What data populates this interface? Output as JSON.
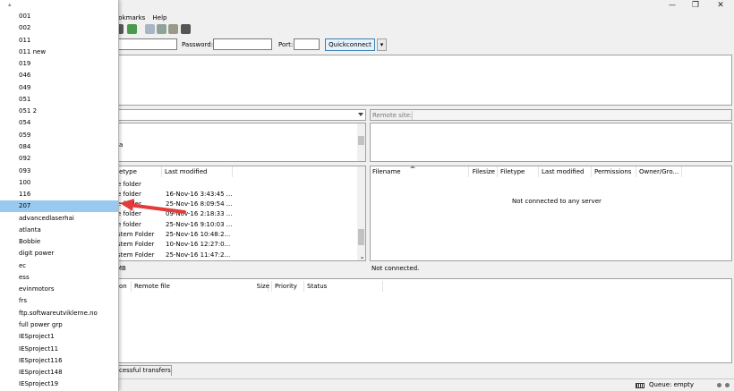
{
  "menu": {
    "bookmarks": "ookmarks",
    "help": "Help"
  },
  "window_controls": {
    "minimize": "—",
    "restore": "❐",
    "close": "✕"
  },
  "quickconnect": {
    "password_label": "Password:",
    "port_label": "Port:",
    "button_label": "Quickconnect",
    "dropdown_arrow": "▾"
  },
  "remote_site": {
    "label": "Remote site:"
  },
  "local_tree": {
    "partial_text": "a"
  },
  "local_files": {
    "headers": [
      "letype",
      "Last modified"
    ],
    "rows": [
      [
        "e folder",
        ""
      ],
      [
        "e folder",
        "16-Nov-16 3:43:45 ..."
      ],
      [
        "e folder",
        "25-Nov-16 8:09:54 ..."
      ],
      [
        "e folder",
        "09-Nov-16 2:18:33 ..."
      ],
      [
        "e folder",
        "25-Nov-16 9:10:03 ..."
      ],
      [
        "stem Folder",
        "25-Nov-16 10:48:2..."
      ],
      [
        "stem Folder",
        "10-Nov-16 12:27:0..."
      ],
      [
        "stem Folder",
        "25-Nov-16 11:47:2..."
      ]
    ],
    "status": "MB"
  },
  "remote_files": {
    "headers": [
      "Filename",
      "Filesize",
      "Filetype",
      "Last modified",
      "Permissions",
      "Owner/Gro..."
    ],
    "empty_message": "Not connected to any server",
    "status": "Not connected."
  },
  "queue": {
    "headers": [
      "ion",
      "Remote file",
      "Size",
      "Priority",
      "Status"
    ],
    "tab_label": "cessful transfers",
    "status": "Queue: empty"
  },
  "dropdown": {
    "scroll_up": "▴",
    "selected_index": 16,
    "items": [
      "001",
      "002",
      "011",
      "011 new",
      "019",
      "046",
      "049",
      "051",
      "051 2",
      "054",
      "059",
      "084",
      "092",
      "093",
      "100",
      "116",
      "207",
      "advancedlaserhai",
      "atlanta",
      "Bobbie",
      "digit power",
      "ec",
      "ess",
      "evinmotors",
      "frs",
      "ftp.softwareutviklerne.no",
      "full power grp",
      "IESproject1",
      "IESproject11",
      "IESproject116",
      "IESproject148",
      "IESproject19"
    ]
  },
  "colors": {
    "selection": "#99c9ef",
    "arrow": "#e23b3b",
    "quickconnect_border": "#3c7fb1"
  }
}
